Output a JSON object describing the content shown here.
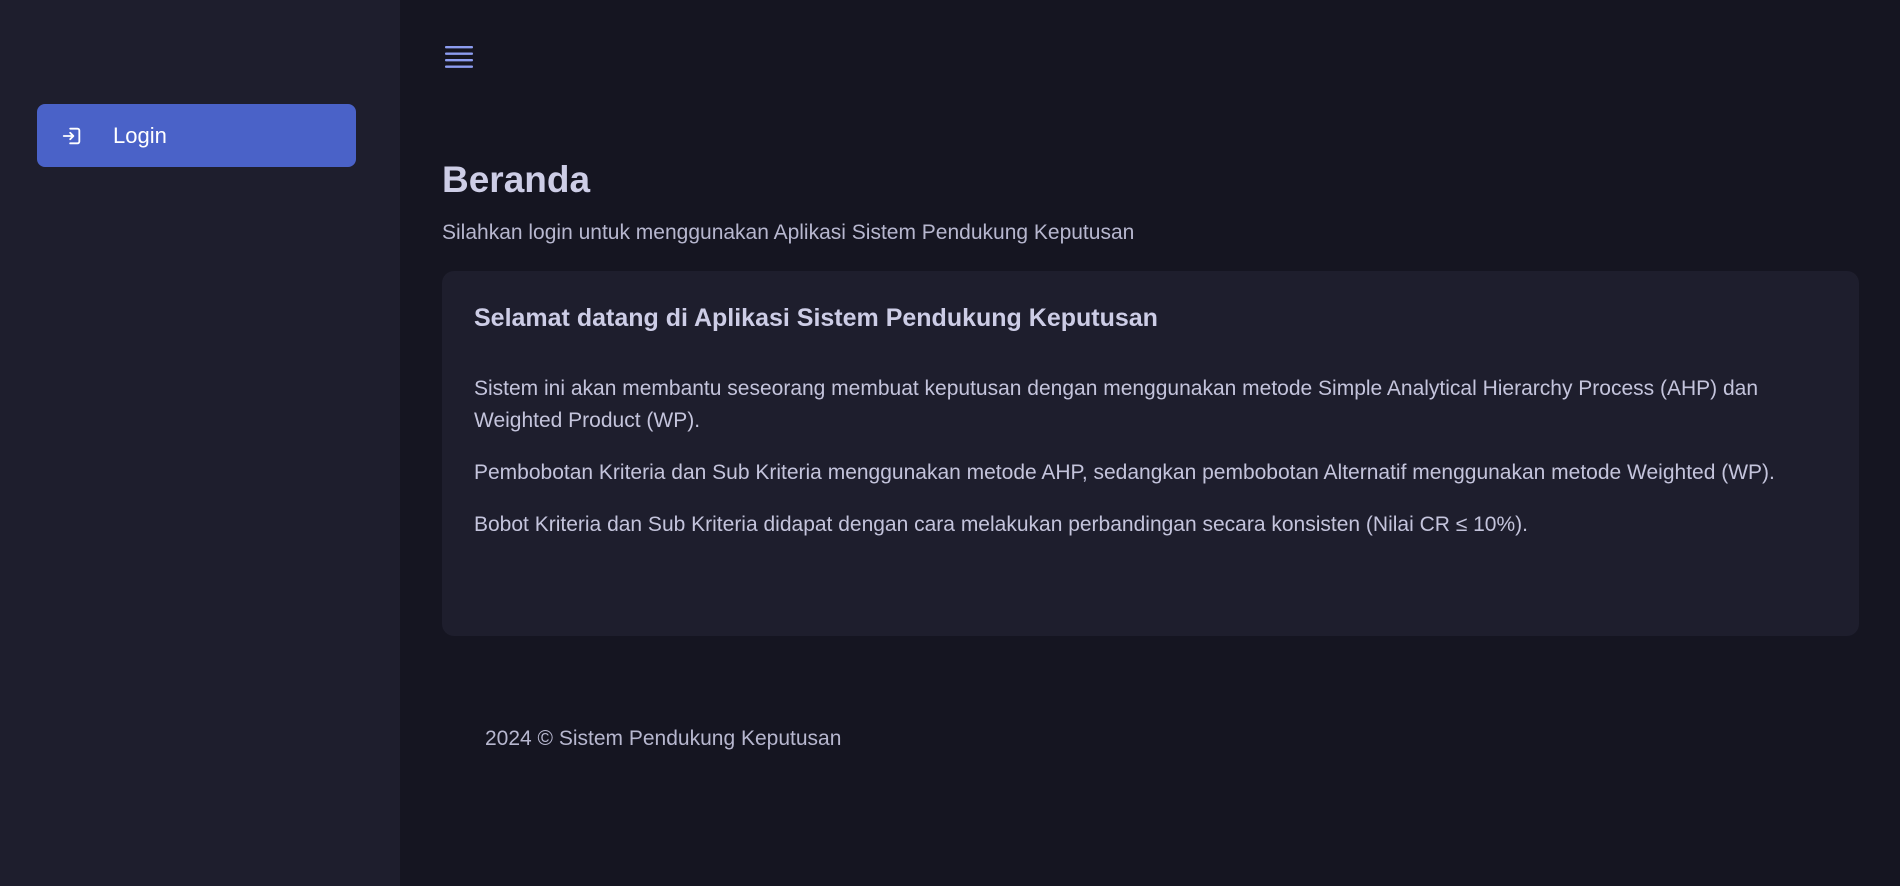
{
  "sidebar": {
    "items": [
      {
        "label": "Login",
        "icon": "login-icon"
      }
    ]
  },
  "header": {
    "menu_icon": "hamburger-menu-icon"
  },
  "main": {
    "title": "Beranda",
    "subtitle": "Silahkan login untuk menggunakan Aplikasi Sistem Pendukung Keputusan",
    "card": {
      "title": "Selamat datang di Aplikasi Sistem Pendukung Keputusan",
      "paragraphs": [
        "Sistem ini akan membantu seseorang membuat keputusan dengan menggunakan metode Simple Analytical Hierarchy Process (AHP) dan Weighted Product (WP).",
        "Pembobotan Kriteria dan Sub Kriteria menggunakan metode AHP, sedangkan pembobotan Alternatif menggunakan metode Weighted (WP).",
        "Bobot Kriteria dan Sub Kriteria didapat dengan cara melakukan perbandingan secara konsisten (Nilai CR ≤ 10%)."
      ]
    }
  },
  "footer": {
    "text": "2024 © Sistem Pendukung Keputusan"
  },
  "colors": {
    "background": "#151521",
    "sidebar": "#1e1e2d",
    "accent": "#4a62c8",
    "card": "#1e1e2d",
    "heading": "#cdcde6",
    "text": "#c4c4dc",
    "icon": "#8c9cf0"
  }
}
